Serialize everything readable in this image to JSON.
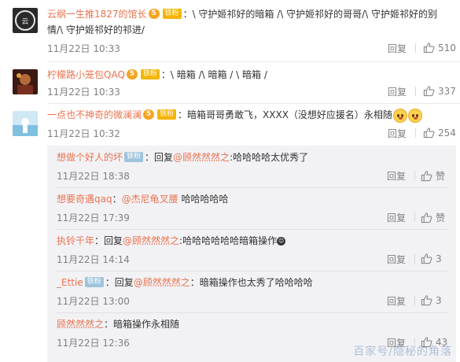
{
  "comments": [
    {
      "name": "云纲一生推1827的馆长",
      "vip": "5",
      "fan_badge": "铁粉",
      "text": "：\\ 守护姬祁好的暗箱 /\\ 守护姬祁好的哥哥/\\ 守护姬祁好的别情/\\ 守护姬祁好的祁进/",
      "time": "11月22日 10:33",
      "reply_label": "回复",
      "likes": "510"
    },
    {
      "name": "柠檬路小笼包QAQ",
      "vip": "5",
      "fan_badge": "铁粉",
      "text": "：\\ 暗箱 /\\ 暗箱 / \\ 暗箱 /",
      "time": "11月22日 10:33",
      "reply_label": "回复",
      "likes": "337"
    },
    {
      "name": "一点也不神奇的微澜澜",
      "vip": "5",
      "fan_badge": "铁粉",
      "text": "：暗箱哥哥勇敢飞，XXXX（没想好应援名）永相随",
      "time": "11月22日 10:32",
      "reply_label": "回复",
      "likes": "254"
    }
  ],
  "replies": [
    {
      "name": "想做个好人的坏",
      "badge": "铁粉",
      "prefix": "：回复",
      "mention": "@顾然然然之",
      "text": ":哈哈哈哈太优秀了",
      "time": "11月22日 18:38",
      "reply_label": "回复",
      "likes": "赞"
    },
    {
      "name": "想要奇遇qaq",
      "badge": "",
      "prefix": "：",
      "mention": "@杰尼龟叉腰",
      "text": " 哈哈哈哈哈",
      "time": "11月22日 17:39",
      "reply_label": "回复",
      "likes": "赞"
    },
    {
      "name": "执铃千年",
      "badge": "",
      "prefix": "：回复",
      "mention": "@顾然然然之",
      "text": ":哈哈哈哈哈哈暗箱操作",
      "time": "11月22日 14:14",
      "reply_label": "回复",
      "likes": "3"
    },
    {
      "name": "_Ettie",
      "badge": "铁粉",
      "prefix": "：回复",
      "mention": "@顾然然然之",
      "text": "：暗箱操作也太秀了哈哈哈哈",
      "time": "11月22日 13:00",
      "reply_label": "回复",
      "likes": "3"
    },
    {
      "name": "顾然然然之",
      "badge": "",
      "prefix": "：",
      "mention": "",
      "text": "暗箱操作永相随",
      "time": "11月22日 12:36",
      "reply_label": "回复",
      "likes": "43"
    }
  ],
  "watermark": "百家号/隐秘的角落",
  "colors": {
    "name": "#eb7350",
    "meta": "#808080",
    "reply_bg": "#f2f2f5"
  }
}
